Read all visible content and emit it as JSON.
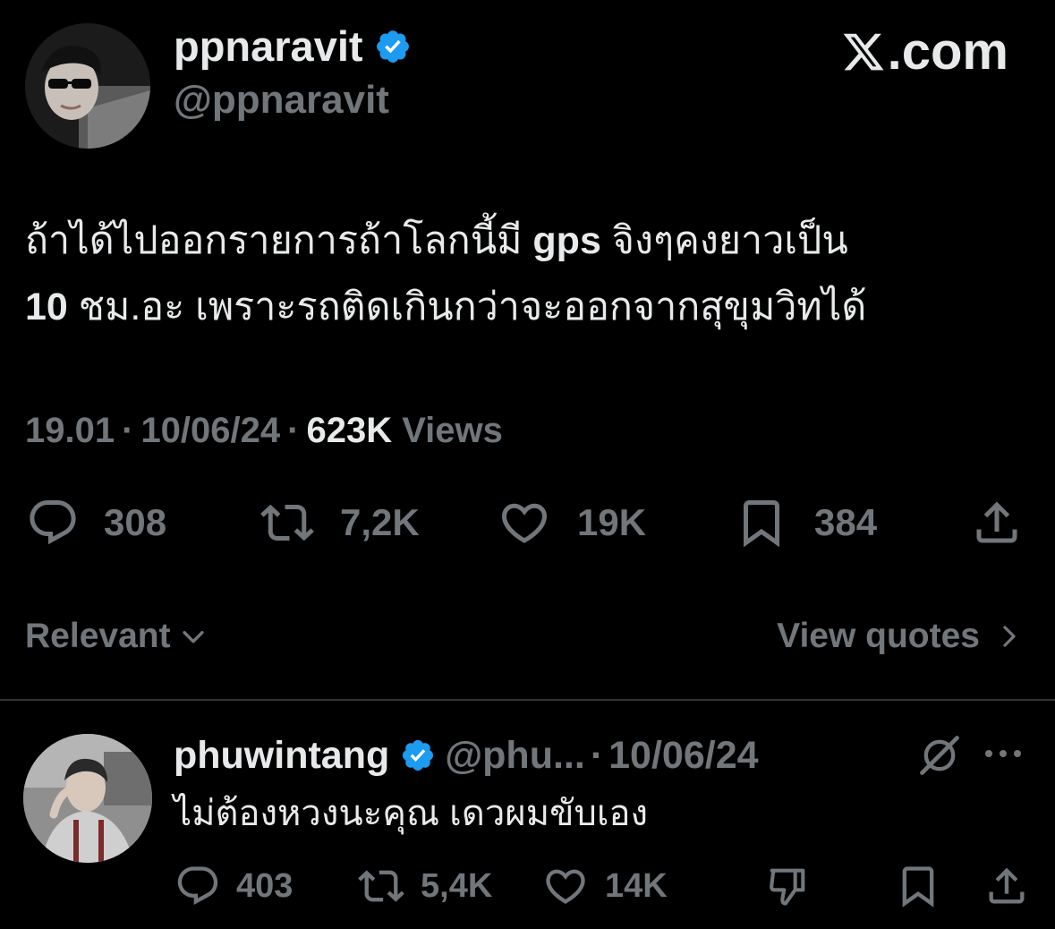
{
  "brand": {
    "label": "𝕏.com",
    "suffix": ".com"
  },
  "author": {
    "display_name": "ppnaravit",
    "handle": "@ppnaravit",
    "verified": true
  },
  "tweet": {
    "line1_prefix": "ถ้าได้ไปออกรายการถ้าโลกนี้มี ",
    "line1_bold": "gps",
    "line1_suffix": " จิงๆคงยาวเป็น",
    "line2_bold": "10",
    "line2_suffix": " ชม.อะ เพราะรถติดเกินกว่าจะออกจากสุขุมวิทได้"
  },
  "meta": {
    "time": "19.01",
    "date": "10/06/24",
    "views_count": "623K",
    "views_label": "Views",
    "separator": "·"
  },
  "actions": {
    "replies": "308",
    "reposts": "7,2K",
    "likes": "19K",
    "bookmarks": "384"
  },
  "sort": {
    "label": "Relevant"
  },
  "quotes_link": {
    "label": "View quotes"
  },
  "reply": {
    "display_name": "phuwintang",
    "handle": "@phu...",
    "separator": "·",
    "date": "10/06/24",
    "text": "ไม่ต้องหวงนะคุณ เดวผมขับเอง",
    "replies": "403",
    "reposts": "5,4K",
    "likes": "14K"
  },
  "colors": {
    "background": "#000000",
    "text": "#e7e9ea",
    "secondary": "#71767b",
    "verified": "#1d9bf0",
    "divider": "#2f3336"
  },
  "icons": {
    "verified": "verified-badge-icon",
    "reply": "speech-bubble-icon",
    "repost": "repost-arrows-icon",
    "like": "heart-icon",
    "bookmark": "bookmark-icon",
    "share": "share-upload-icon",
    "chevron_down": "chevron-down-icon",
    "chevron_right": "chevron-right-icon",
    "grok": "grok-slash-icon",
    "more": "more-dots-icon",
    "downvote": "thumbs-down-icon"
  }
}
